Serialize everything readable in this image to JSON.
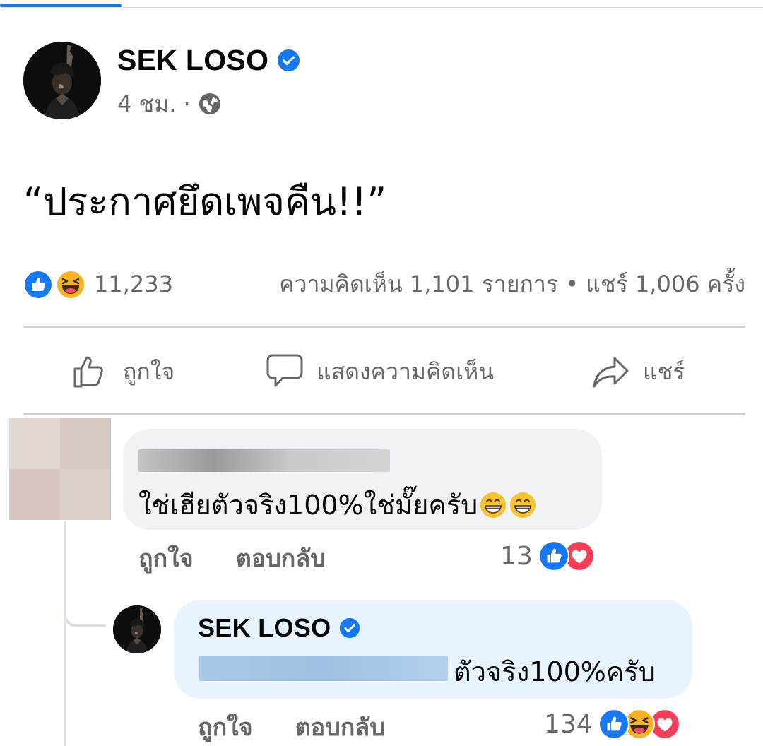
{
  "post": {
    "author": "SEK LOSO",
    "verified": true,
    "time": "4 ชม.",
    "separator": "·",
    "audience_icon": "globe-icon",
    "text": "“ประกาศยึดเพจคืน!!”",
    "reaction_icons": [
      "like-reaction-icon",
      "haha-reaction-icon"
    ],
    "reaction_count": "11,233",
    "stats": "ความคิดเห็น 1,101 รายการ • แชร์ 1,006 ครั้ง"
  },
  "actions": {
    "like": "ถูกใจ",
    "comment": "แสดงความคิดเห็น",
    "share": "แชร์"
  },
  "comments": [
    {
      "author_redacted": true,
      "text": "ใช่เฮียตัวจริง100%ใช่มั๊ยครับ",
      "emoji_count": 2,
      "like_label": "ถูกใจ",
      "reply_label": "ตอบกลับ",
      "reaction_count": "13",
      "reaction_icons": [
        "like-reaction-icon",
        "love-reaction-icon"
      ],
      "reply": {
        "author": "SEK LOSO",
        "verified": true,
        "mention_redacted": true,
        "text": "ตัวจริง100%ครับ",
        "like_label": "ถูกใจ",
        "reply_label": "ตอบกลับ",
        "reaction_count": "134",
        "reaction_icons": [
          "like-reaction-icon",
          "haha-reaction-icon",
          "love-reaction-icon"
        ]
      }
    }
  ],
  "colors": {
    "brand_blue": "#1877f2",
    "secondary_text": "#65676b",
    "bubble": "#f0f2f5",
    "reply_bubble": "#e7f3ff",
    "love_red": "#f33e58",
    "haha_yellow": "#f7b125"
  }
}
